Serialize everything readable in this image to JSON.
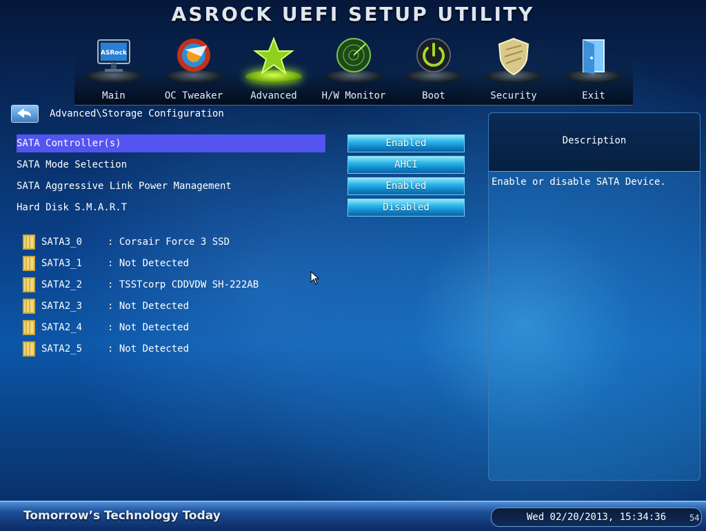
{
  "app_title": "ASROCK UEFI SETUP UTILITY",
  "nav": [
    {
      "label": "Main",
      "icon": "asrock-monitor-icon",
      "active": false
    },
    {
      "label": "OC Tweaker",
      "icon": "oc-speed-icon",
      "active": false
    },
    {
      "label": "Advanced",
      "icon": "star-icon",
      "active": true
    },
    {
      "label": "H/W Monitor",
      "icon": "radar-icon",
      "active": false
    },
    {
      "label": "Boot",
      "icon": "power-icon",
      "active": false
    },
    {
      "label": "Security",
      "icon": "shield-icon",
      "active": false
    },
    {
      "label": "Exit",
      "icon": "exit-door-icon",
      "active": false
    }
  ],
  "breadcrumb": "Advanced\\Storage Configuration",
  "settings": [
    {
      "label": "SATA Controller(s)",
      "value": "Enabled",
      "selected": true
    },
    {
      "label": "SATA Mode Selection",
      "value": "AHCI",
      "selected": false
    },
    {
      "label": "SATA Aggressive Link Power Management",
      "value": "Enabled",
      "selected": false
    },
    {
      "label": "Hard Disk S.M.A.R.T",
      "value": "Disabled",
      "selected": false
    }
  ],
  "devices": [
    {
      "port": "SATA3_0",
      "value": ": Corsair Force 3 SSD"
    },
    {
      "port": "SATA3_1",
      "value": ": Not Detected"
    },
    {
      "port": "SATA2_2",
      "value": ": TSSTcorp CDDVDW SH-222AB"
    },
    {
      "port": "SATA2_3",
      "value": ": Not Detected"
    },
    {
      "port": "SATA2_4",
      "value": ": Not Detected"
    },
    {
      "port": "SATA2_5",
      "value": ": Not Detected"
    }
  ],
  "description": {
    "title": "Description",
    "text": "Enable or disable SATA Device."
  },
  "footer": {
    "tagline": "Tomorrow’s Technology Today",
    "datetime": "Wed 02/20/2013, 15:34:36",
    "corner_mark": "54"
  },
  "colors": {
    "selected_row": "#5454f0",
    "value_button": "#29b6e8",
    "background": "#0a3f86",
    "active_tab_glow": "#b6ff2c"
  }
}
